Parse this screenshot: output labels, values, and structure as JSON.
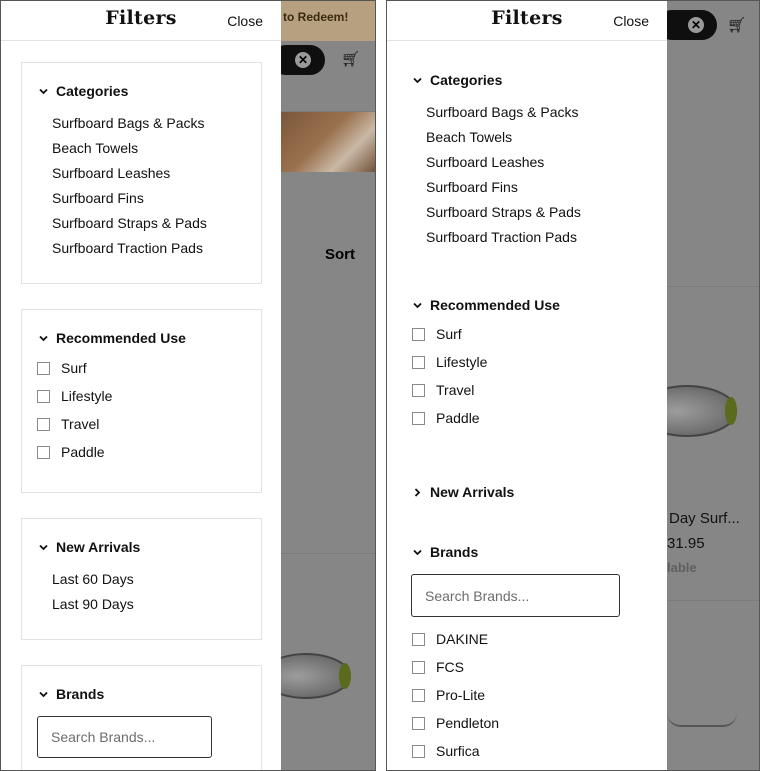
{
  "background": {
    "promo_text": "to Redeem!",
    "sort_label": "Sort",
    "product_title_partial": "Day Surf...",
    "product_price_partial": "31.95",
    "product_status_partial": "lable",
    "cart_icon": "cart-icon",
    "clear_icon": "clear-search-icon"
  },
  "panel_a": {
    "title": "Filters",
    "close_label": "Close",
    "categories": {
      "title": "Categories",
      "items": [
        "Surfboard Bags & Packs",
        "Beach Towels",
        "Surfboard Leashes",
        "Surfboard Fins",
        "Surfboard Straps & Pads",
        "Surfboard Traction Pads"
      ]
    },
    "recommended_use": {
      "title": "Recommended Use",
      "options": [
        "Surf",
        "Lifestyle",
        "Travel",
        "Paddle"
      ]
    },
    "new_arrivals": {
      "title": "New Arrivals",
      "items": [
        "Last 60 Days",
        "Last 90 Days"
      ]
    },
    "brands": {
      "title": "Brands",
      "search_placeholder": "Search Brands..."
    }
  },
  "panel_b": {
    "title": "Filters",
    "close_label": "Close",
    "categories": {
      "title": "Categories",
      "items": [
        "Surfboard Bags & Packs",
        "Beach Towels",
        "Surfboard Leashes",
        "Surfboard Fins",
        "Surfboard Straps & Pads",
        "Surfboard Traction Pads"
      ]
    },
    "recommended_use": {
      "title": "Recommended Use",
      "options": [
        "Surf",
        "Lifestyle",
        "Travel",
        "Paddle"
      ]
    },
    "new_arrivals": {
      "title": "New Arrivals"
    },
    "brands": {
      "title": "Brands",
      "search_placeholder": "Search Brands...",
      "options": [
        "DAKINE",
        "FCS",
        "Pro-Lite",
        "Pendleton",
        "Surfica"
      ]
    }
  }
}
